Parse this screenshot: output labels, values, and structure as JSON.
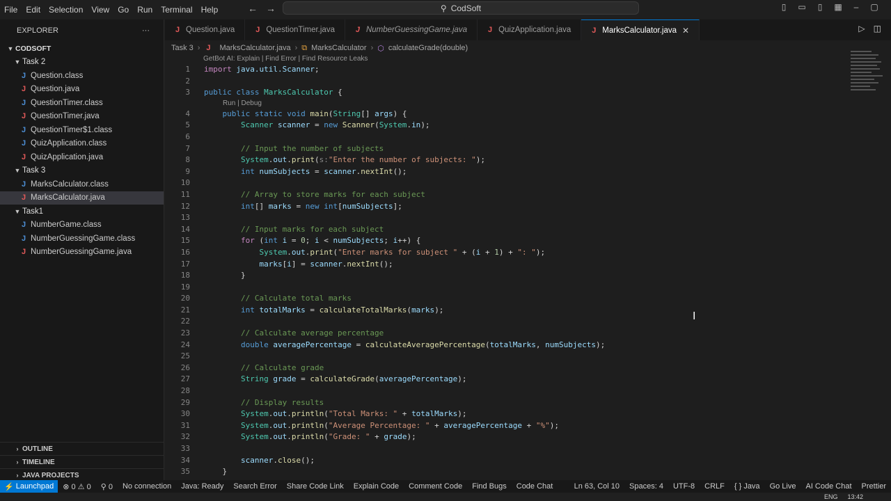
{
  "menu": [
    "File",
    "Edit",
    "Selection",
    "View",
    "Go",
    "Run",
    "Terminal",
    "Help"
  ],
  "search": {
    "label": "CodSoft"
  },
  "explorer": {
    "title": "EXPLORER",
    "more": "···",
    "root": "CODSOFT",
    "task2": {
      "label": "Task 2",
      "files": [
        {
          "name": "Question.class",
          "kind": "class"
        },
        {
          "name": "Question.java",
          "kind": "java"
        },
        {
          "name": "QuestionTimer.class",
          "kind": "class"
        },
        {
          "name": "QuestionTimer.java",
          "kind": "java"
        },
        {
          "name": "QuestionTimer$1.class",
          "kind": "class"
        },
        {
          "name": "QuizApplication.class",
          "kind": "class"
        },
        {
          "name": "QuizApplication.java",
          "kind": "java"
        }
      ]
    },
    "task3": {
      "label": "Task 3",
      "files": [
        {
          "name": "MarksCalculator.class",
          "kind": "class"
        },
        {
          "name": "MarksCalculator.java",
          "kind": "java"
        }
      ]
    },
    "task1": {
      "label": "Task1",
      "files": [
        {
          "name": "NumberGame.class",
          "kind": "class"
        },
        {
          "name": "NumberGuessingGame.class",
          "kind": "class"
        },
        {
          "name": "NumberGuessingGame.java",
          "kind": "java"
        }
      ]
    },
    "sections": [
      "OUTLINE",
      "TIMELINE",
      "JAVA PROJECTS"
    ]
  },
  "tabs": [
    "Question.java",
    "QuestionTimer.java",
    "NumberGuessingGame.java",
    "QuizApplication.java",
    "MarksCalculator.java"
  ],
  "breadcrumb": {
    "folder": "Task 3",
    "file": "MarksCalculator.java",
    "class": "MarksCalculator",
    "method": "calculateGrade(double)"
  },
  "codelens": {
    "top": "GetBot AI: Explain | Find Error | Find Resource Leaks",
    "main": "Run | Debug"
  },
  "code": {
    "l1": "import java.util.Scanner;",
    "l3a": "public class ",
    "l3b": "MarksCalculator",
    "l3c": " {",
    "l7": "// Input the number of subjects",
    "l8s": "\"Enter the number of subjects: \"",
    "l11": "// Array to store marks for each subject",
    "l14": "// Input marks for each subject",
    "l16s": "\"Enter marks for subject \"",
    "l16t": "\": \"",
    "l20": "// Calculate total marks",
    "l23": "// Calculate average percentage",
    "l26": "// Calculate grade",
    "l29": "// Display results",
    "l30s": "\"Total Marks: \"",
    "l31s": "\"Average Percentage: \"",
    "l31t": "\"%\"",
    "l32s": "\"Grade: \""
  },
  "status": {
    "remote": "Launchpad",
    "problems": "⊗ 0 ⚠ 0",
    "ports": "⚲ 0",
    "connection": "No connection",
    "java": "Java: Ready",
    "items": [
      "Search Error",
      "Share Code Link",
      "Explain Code",
      "Comment Code",
      "Find Bugs",
      "Code Chat"
    ],
    "position": "Ln 63, Col 10",
    "spaces": "Spaces: 4",
    "encoding": "UTF-8",
    "eol": "CRLF",
    "lang": "{ } Java",
    "golive": "Go Live",
    "aichat": "AI Code Chat",
    "prettier": "Prettier"
  },
  "taskbar": {
    "lang": "ENG",
    "time": "13:42"
  }
}
